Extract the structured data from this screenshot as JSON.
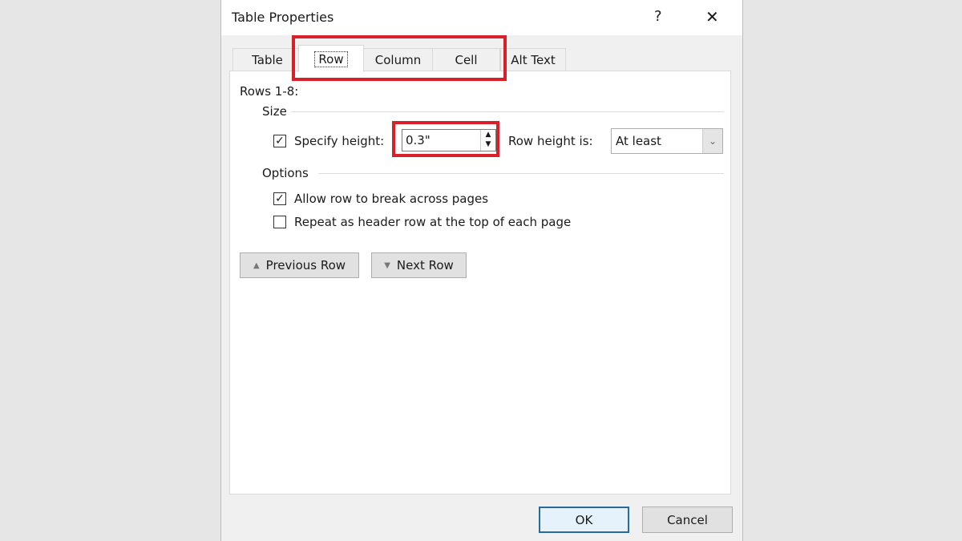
{
  "dialog": {
    "title": "Table Properties",
    "help_label": "?",
    "close_label": "✕"
  },
  "tabs": [
    {
      "label": "Table"
    },
    {
      "label": "Row",
      "active": true
    },
    {
      "label": "Column"
    },
    {
      "label": "Cell"
    },
    {
      "label": "Alt Text"
    }
  ],
  "row": {
    "rows_label": "Rows 1-8:",
    "size_label": "Size",
    "specify_height": {
      "label": "Specify height:",
      "checked": true
    },
    "height_value": "0.3\"",
    "row_height_is_label": "Row height is:",
    "row_height_is_value": "At least",
    "options_label": "Options",
    "allow_break": {
      "label": "Allow row to break across pages",
      "checked": true
    },
    "repeat_header": {
      "label": "Repeat as header row at the top of each page",
      "checked": false
    },
    "previous_row_label": "Previous Row",
    "next_row_label": "Next Row"
  },
  "footer": {
    "ok_label": "OK",
    "cancel_label": "Cancel"
  },
  "highlight_color": "#d8202b"
}
